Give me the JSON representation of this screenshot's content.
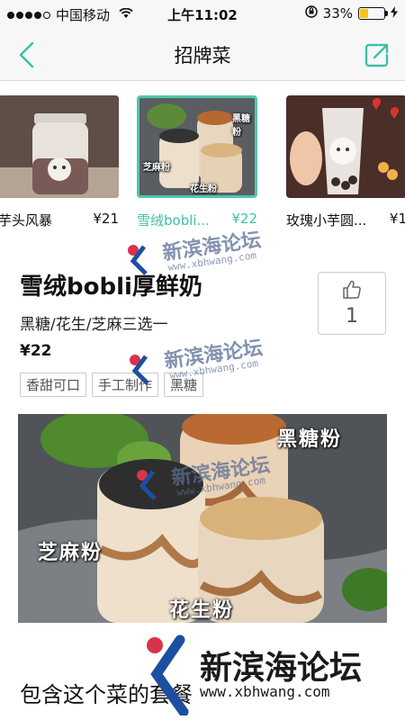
{
  "status_bar": {
    "carrier": "中国移动",
    "time": "上午11:02",
    "battery_percent": "33%",
    "battery_level": 0.33,
    "battery_color": "#f5c518"
  },
  "nav": {
    "title": "招牌菜",
    "back_icon": "chevron-left-icon",
    "share_icon": "share-icon",
    "accent_color": "#3fc0a4"
  },
  "carousel": {
    "items": [
      {
        "name": "芋头风暴",
        "price": "¥21",
        "selected": false
      },
      {
        "name": "雪绒bobli...",
        "price": "¥22",
        "selected": true,
        "image_labels": [
          "黑糖粉",
          "芝麻粉",
          "花生粉"
        ]
      },
      {
        "name": "玫瑰小芋圆...",
        "price": "¥1",
        "selected": false
      }
    ]
  },
  "dish": {
    "name": "雪绒bobli厚鲜奶",
    "description": "黑糖/花生/芝麻三选一",
    "price": "¥22",
    "tags": [
      "香甜可口",
      "手工制作",
      "黑糖"
    ],
    "like_count": "1",
    "like_icon": "thumbs-up-icon"
  },
  "hero_image": {
    "labels": {
      "black_sugar": "黑糖粉",
      "sesame": "芝麻粉",
      "peanut": "花生粉"
    }
  },
  "section": {
    "combo_title": "包含这个菜的套餐"
  },
  "watermark": {
    "site_name": "新滨海论坛",
    "site_url": "www.xbhwang.com"
  }
}
